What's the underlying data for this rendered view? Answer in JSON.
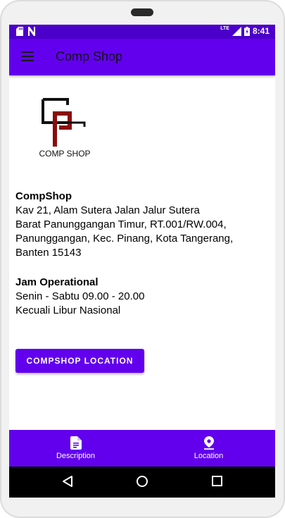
{
  "status_bar": {
    "time": "8:41",
    "network": "LTE",
    "left_icons": [
      "sd-card-icon",
      "n-notification-icon"
    ],
    "background_color": "#4b00c9"
  },
  "app_bar": {
    "title": "Comp Shop",
    "menu_icon": "hamburger-menu-icon",
    "color": "#6200ee"
  },
  "logo": {
    "caption": "COMP SHOP"
  },
  "store": {
    "name": "CompShop",
    "address_lines": [
      "Kav 21, Alam Sutera Jalan Jalur Sutera",
      "Barat Panunggangan Timur, RT.001/RW.004,",
      "Panunggangan, Kec. Pinang, Kota Tangerang,",
      "Banten 15143"
    ]
  },
  "hours": {
    "title": "Jam Operational",
    "lines": [
      "Senin - Sabtu 09.00 - 20.00",
      "Kecuali Libur Nasional"
    ]
  },
  "location_button": {
    "label": "COMPSHOP LOCATION"
  },
  "bottom_nav": {
    "items": [
      {
        "label": "Description",
        "icon": "document-icon"
      },
      {
        "label": "Location",
        "icon": "location-pin-icon"
      }
    ]
  }
}
